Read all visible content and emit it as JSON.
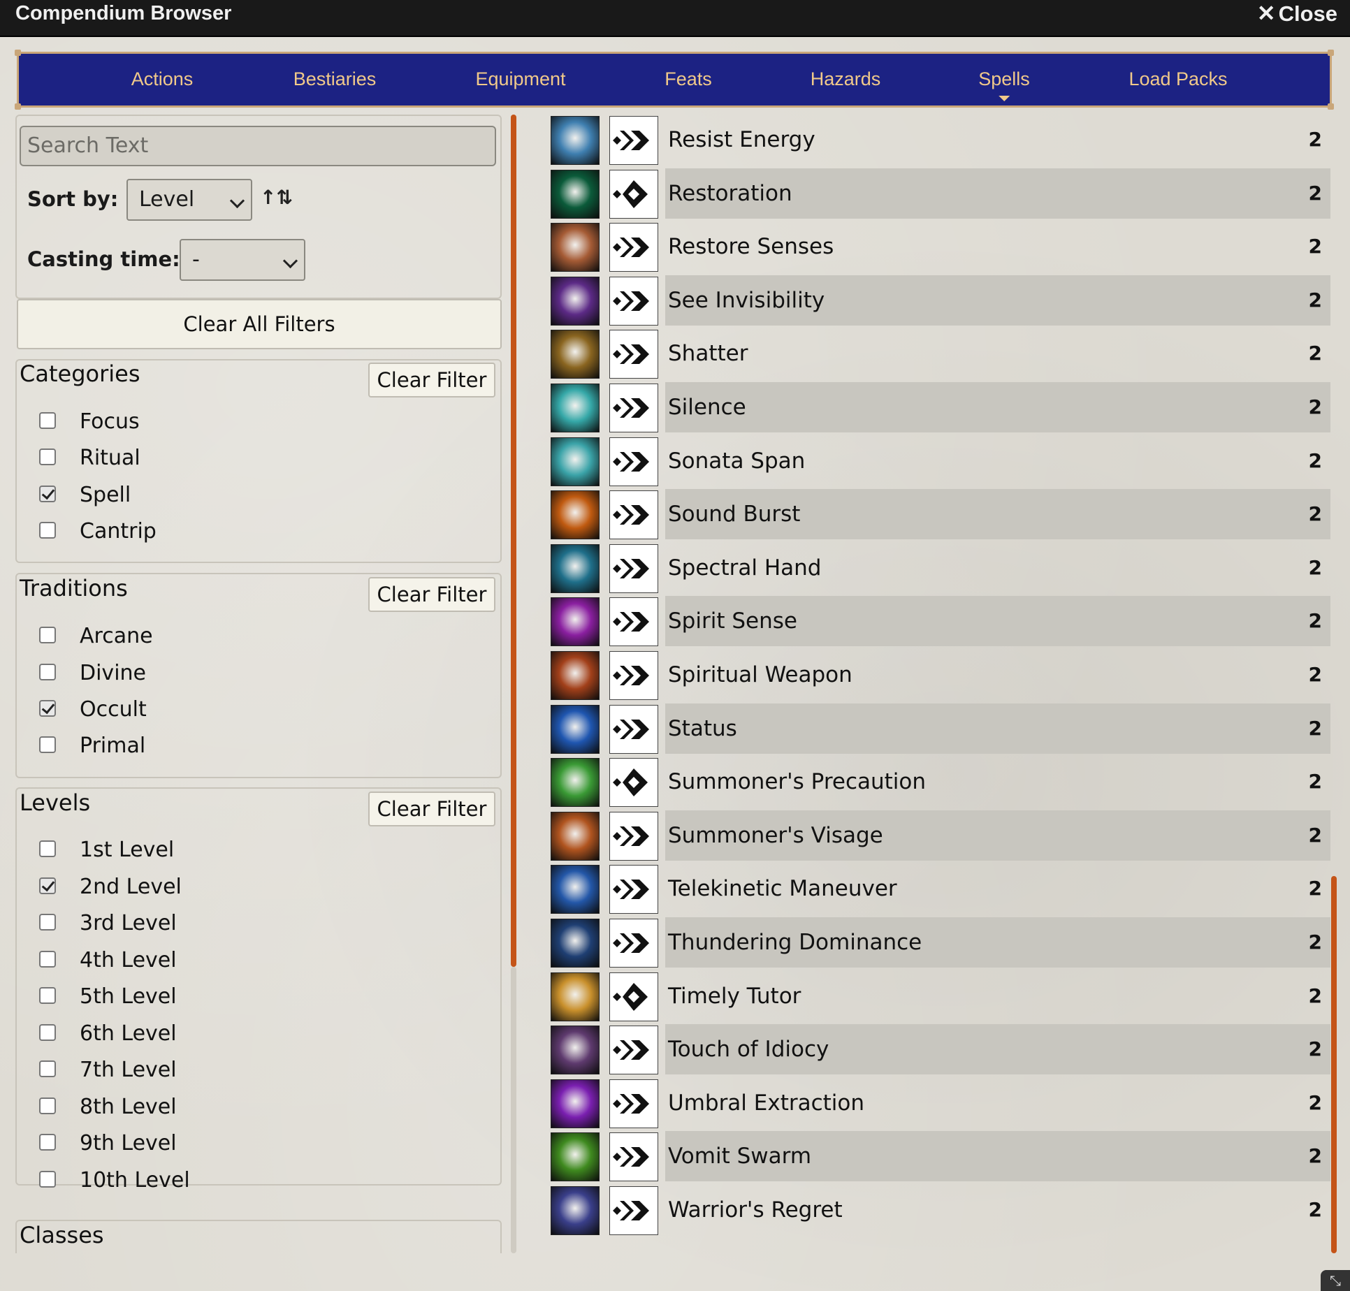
{
  "window": {
    "title": "Compendium Browser",
    "close_label": "Close"
  },
  "tabs": [
    {
      "label": "Actions"
    },
    {
      "label": "Bestiaries"
    },
    {
      "label": "Equipment"
    },
    {
      "label": "Feats"
    },
    {
      "label": "Hazards"
    },
    {
      "label": "Spells",
      "active": true
    },
    {
      "label": "Load Packs"
    }
  ],
  "filters": {
    "search_placeholder": "Search Text",
    "sort_label": "Sort by:",
    "sort_value": "Level",
    "sort_direction_icon": "sort-ascending-icon",
    "casting_label": "Casting time:",
    "casting_value": "-",
    "clear_all_label": "Clear All Filters",
    "clear_filter_label": "Clear Filter",
    "categories": {
      "title": "Categories",
      "options": [
        {
          "label": "Focus",
          "checked": false
        },
        {
          "label": "Ritual",
          "checked": false
        },
        {
          "label": "Spell",
          "checked": true
        },
        {
          "label": "Cantrip",
          "checked": false
        }
      ]
    },
    "traditions": {
      "title": "Traditions",
      "options": [
        {
          "label": "Arcane",
          "checked": false
        },
        {
          "label": "Divine",
          "checked": false
        },
        {
          "label": "Occult",
          "checked": true
        },
        {
          "label": "Primal",
          "checked": false
        }
      ]
    },
    "levels": {
      "title": "Levels",
      "options": [
        {
          "label": "1st Level",
          "checked": false
        },
        {
          "label": "2nd Level",
          "checked": true
        },
        {
          "label": "3rd Level",
          "checked": false
        },
        {
          "label": "4th Level",
          "checked": false
        },
        {
          "label": "5th Level",
          "checked": false
        },
        {
          "label": "6th Level",
          "checked": false
        },
        {
          "label": "7th Level",
          "checked": false
        },
        {
          "label": "8th Level",
          "checked": false
        },
        {
          "label": "9th Level",
          "checked": false
        },
        {
          "label": "10th Level",
          "checked": false
        }
      ]
    },
    "classes": {
      "title": "Classes"
    }
  },
  "colors": {
    "tab_bg": "#1c2283",
    "tab_text": "#f0c98a",
    "tab_border": "#c9a679",
    "scrollbar": "#c45418"
  },
  "spells": [
    {
      "name": "Resist Energy",
      "level": "2",
      "actions": 2,
      "icon": "shield-icon",
      "icon_color": "#3f7fb0"
    },
    {
      "name": "Restoration",
      "level": "2",
      "actions": 1,
      "icon": "heart-icon",
      "icon_color": "#0b5b3a"
    },
    {
      "name": "Restore Senses",
      "level": "2",
      "actions": 2,
      "icon": "eye-closeup-icon",
      "icon_color": "#a55b35"
    },
    {
      "name": "See Invisibility",
      "level": "2",
      "actions": 2,
      "icon": "purple-eye-icon",
      "icon_color": "#5c2a86"
    },
    {
      "name": "Shatter",
      "level": "2",
      "actions": 2,
      "icon": "shattered-shield-icon",
      "icon_color": "#8a6520"
    },
    {
      "name": "Silence",
      "level": "2",
      "actions": 2,
      "icon": "mask-icon",
      "icon_color": "#35a8a8"
    },
    {
      "name": "Sonata Span",
      "level": "2",
      "actions": 2,
      "icon": "wave-icon",
      "icon_color": "#3aa3a8"
    },
    {
      "name": "Sound Burst",
      "level": "2",
      "actions": 2,
      "icon": "burst-ring-icon",
      "icon_color": "#c05a10"
    },
    {
      "name": "Spectral Hand",
      "level": "2",
      "actions": 2,
      "icon": "ghost-hand-icon",
      "icon_color": "#1f6f8a"
    },
    {
      "name": "Spirit Sense",
      "level": "2",
      "actions": 2,
      "icon": "pink-orb-icon",
      "icon_color": "#8a1fa0"
    },
    {
      "name": "Spiritual Weapon",
      "level": "2",
      "actions": 2,
      "icon": "sword-icon",
      "icon_color": "#a2401a"
    },
    {
      "name": "Status",
      "level": "2",
      "actions": 2,
      "icon": "blue-eye-icon",
      "icon_color": "#1f56b0"
    },
    {
      "name": "Summoner's Precaution",
      "level": "2",
      "actions": 1,
      "icon": "ankh-icon",
      "icon_color": "#3a9a35"
    },
    {
      "name": "Summoner's Visage",
      "level": "2",
      "actions": 2,
      "icon": "demon-face-icon",
      "icon_color": "#b0541f"
    },
    {
      "name": "Telekinetic Maneuver",
      "level": "2",
      "actions": 2,
      "icon": "blue-bolt-icon",
      "icon_color": "#2357a8"
    },
    {
      "name": "Thundering Dominance",
      "level": "2",
      "actions": 2,
      "icon": "horned-skull-icon",
      "icon_color": "#1f3f73"
    },
    {
      "name": "Timely Tutor",
      "level": "2",
      "actions": 1,
      "icon": "scroll-icon",
      "icon_color": "#c9902c"
    },
    {
      "name": "Touch of Idiocy",
      "level": "2",
      "actions": 2,
      "icon": "sparkle-hand-icon",
      "icon_color": "#5e3a6e"
    },
    {
      "name": "Umbral Extraction",
      "level": "2",
      "actions": 2,
      "icon": "purple-swirl-icon",
      "icon_color": "#7a1fb0"
    },
    {
      "name": "Vomit Swarm",
      "level": "2",
      "actions": 2,
      "icon": "spider-icon",
      "icon_color": "#3f8a1f"
    },
    {
      "name": "Warrior's Regret",
      "level": "2",
      "actions": 2,
      "icon": "palm-eye-icon",
      "icon_color": "#3a3f8a"
    }
  ]
}
